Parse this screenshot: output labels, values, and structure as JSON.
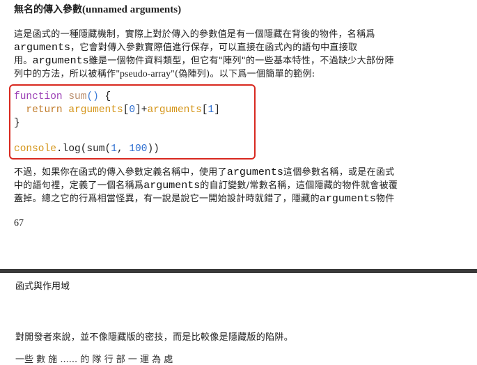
{
  "heading": {
    "zh": "無名的傳入參數",
    "en": "(unnamed arguments)"
  },
  "para1": {
    "l1": "這是函式的一種隱藏機制，實際上對於傳入的參數值是有一個隱藏在背後的物件，名稱爲",
    "l2_code": "arguments",
    "l2_text": "，它會對傳入參數實際值進行保存，可以直接在函式內的語句中直接取",
    "l3_a": "用。",
    "l3_code": "arguments",
    "l3_b": "雖是一個物件資料類型，但它有\"陣列\"的一些基本特性，不過缺少大部份陣",
    "l4_a": "列中的方法，所以被稱作",
    "l4_en": "\"pseudo-array\"",
    "l4_b": "(偽陣列)。以下爲一個簡單的範例:"
  },
  "code": {
    "l1_kw": "function",
    "l1_name": "sum",
    "l1_parens": "()",
    "l1_brace": " {",
    "l2_indent": "  ",
    "l2_kw": "return",
    "l2_sp": " ",
    "l2_arg1": "arguments",
    "l2_b1": "[",
    "l2_n1": "0",
    "l2_b2": "]+",
    "l2_arg2": "arguments",
    "l2_b3": "[",
    "l2_n2": "1",
    "l2_b4": "]",
    "l3": "}",
    "l5_obj": "console",
    "l5_call": ".log(sum(",
    "l5_n1": "1",
    "l5_sep": ", ",
    "l5_n2": "100",
    "l5_end": "))"
  },
  "para2": {
    "l1_a": "不過，如果你在函式的傳入參數定義名稱中，使用了",
    "l1_code": "arguments",
    "l1_b": "這個參數名稱，或是在函式",
    "l2_a": "中的語句裡，定義了一個名稱爲",
    "l2_code": "arguments",
    "l2_b": "的自訂變數/常數名稱，這個隱藏的物件就會被覆",
    "l3_a": "蓋掉。總之它的行爲相當怪異，有一說是說它一開始設計時就錯了，隱藏的",
    "l3_code": "arguments",
    "l3_b": "物件"
  },
  "page_number": "67",
  "running_head": "函式與作用域",
  "para3": "對開發者來說，並不像隱藏版的密技，而是比較像是隱藏版的陷阱。",
  "cut_line": "一些 數 施 ...... 的 隊 行 部 一 運 為 處"
}
